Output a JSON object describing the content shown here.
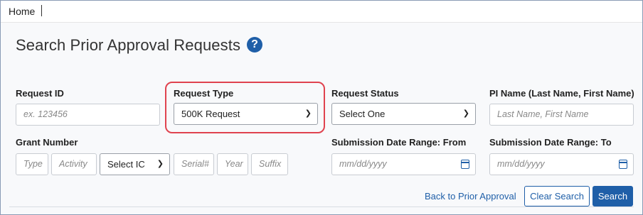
{
  "breadcrumb": {
    "home_label": "Home"
  },
  "page": {
    "title": "Search Prior Approval Requests",
    "help_glyph": "?"
  },
  "form": {
    "request_id": {
      "label": "Request ID",
      "placeholder": "ex. 123456"
    },
    "request_type": {
      "label": "Request Type",
      "value": "500K Request"
    },
    "request_status": {
      "label": "Request Status",
      "value": "Select One"
    },
    "pi_name": {
      "label": "PI Name (Last Name, First Name)",
      "placeholder": "Last Name, First Name"
    },
    "grant_number": {
      "label": "Grant Number",
      "type_placeholder": "Type",
      "activity_placeholder": "Activity",
      "ic_value": "Select IC",
      "serial_placeholder": "Serial#",
      "year_placeholder": "Year",
      "suffix_placeholder": "Suffix"
    },
    "date_from": {
      "label": "Submission Date Range: From",
      "placeholder": "mm/dd/yyyy"
    },
    "date_to": {
      "label": "Submission Date Range: To",
      "placeholder": "mm/dd/yyyy"
    }
  },
  "actions": {
    "back_link": "Back to Prior Approval",
    "clear_label": "Clear Search",
    "search_label": "Search"
  },
  "colors": {
    "accent": "#1f5fa8",
    "highlight": "#e0434f"
  }
}
